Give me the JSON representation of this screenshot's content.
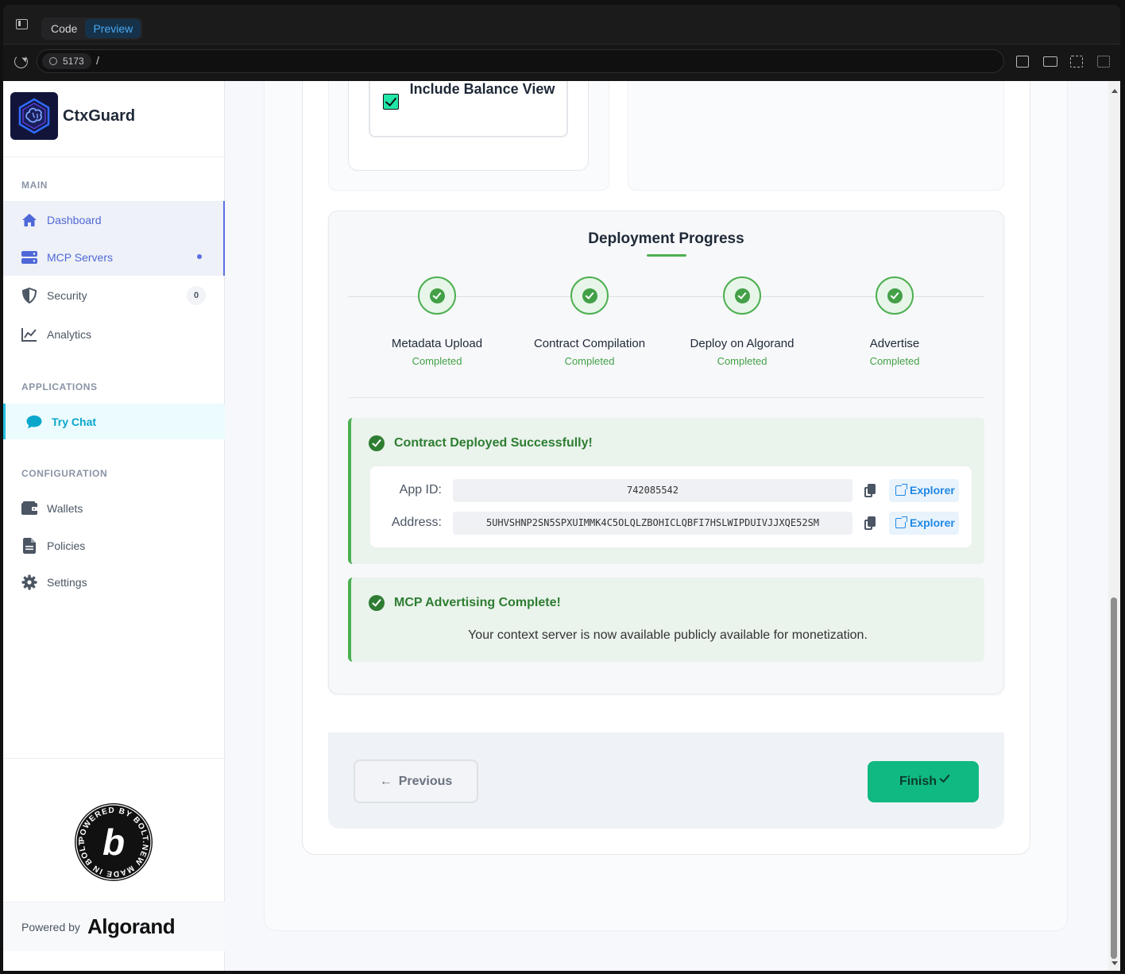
{
  "browser": {
    "tabs": [
      {
        "label": "Code",
        "active": false
      },
      {
        "label": "Preview",
        "active": true
      }
    ],
    "port": "5173",
    "path": "/"
  },
  "sidebar": {
    "brand": "CtxGuard",
    "sections": {
      "main": "MAIN",
      "applications": "APPLICATIONS",
      "configuration": "CONFIGURATION"
    },
    "items": [
      {
        "label": "Dashboard",
        "icon": "home-icon",
        "active": true
      },
      {
        "label": "MCP Servers",
        "icon": "server-icon",
        "active": true,
        "indicator": true
      },
      {
        "label": "Security",
        "icon": "shield-icon",
        "badge": "0"
      },
      {
        "label": "Analytics",
        "icon": "chart-line-icon"
      },
      {
        "label": "Try Chat",
        "icon": "chat-bubble-icon",
        "highlight": true
      },
      {
        "label": "Wallets",
        "icon": "wallet-icon"
      },
      {
        "label": "Policies",
        "icon": "document-icon"
      },
      {
        "label": "Settings",
        "icon": "gear-icon"
      }
    ],
    "powered_by": "Powered by",
    "powered_brand": "Algorand",
    "bolt_badge_text": "POWERED BY BOLT.NEW MADE IN BOLT.NEW"
  },
  "option": {
    "label": "Include Balance View",
    "checked": true
  },
  "deployment": {
    "title": "Deployment Progress",
    "steps": [
      {
        "name": "Metadata Upload",
        "status": "Completed"
      },
      {
        "name": "Contract Compilation",
        "status": "Completed"
      },
      {
        "name": "Deploy on Algorand",
        "status": "Completed"
      },
      {
        "name": "Advertise",
        "status": "Completed"
      }
    ],
    "success_title": "Contract Deployed Successfully!",
    "app_id_label": "App ID:",
    "app_id": "742085542",
    "address_label": "Address:",
    "address": "5UHVSHNP2SN5SPXUIMMK4C5OLQLZBOHICLQBFI7HSLWIPDUIVJJXQE52SM",
    "explorer_label": "Explorer",
    "advert_title": "MCP Advertising Complete!",
    "advert_message": "Your context server is now available publicly available for monetization."
  },
  "footer": {
    "previous_label": "Previous",
    "finish_label": "Finish"
  },
  "colors": {
    "accent": "#5b6ee1",
    "success": "#4caf50",
    "finish": "#10b981",
    "link": "#1e88e5"
  }
}
